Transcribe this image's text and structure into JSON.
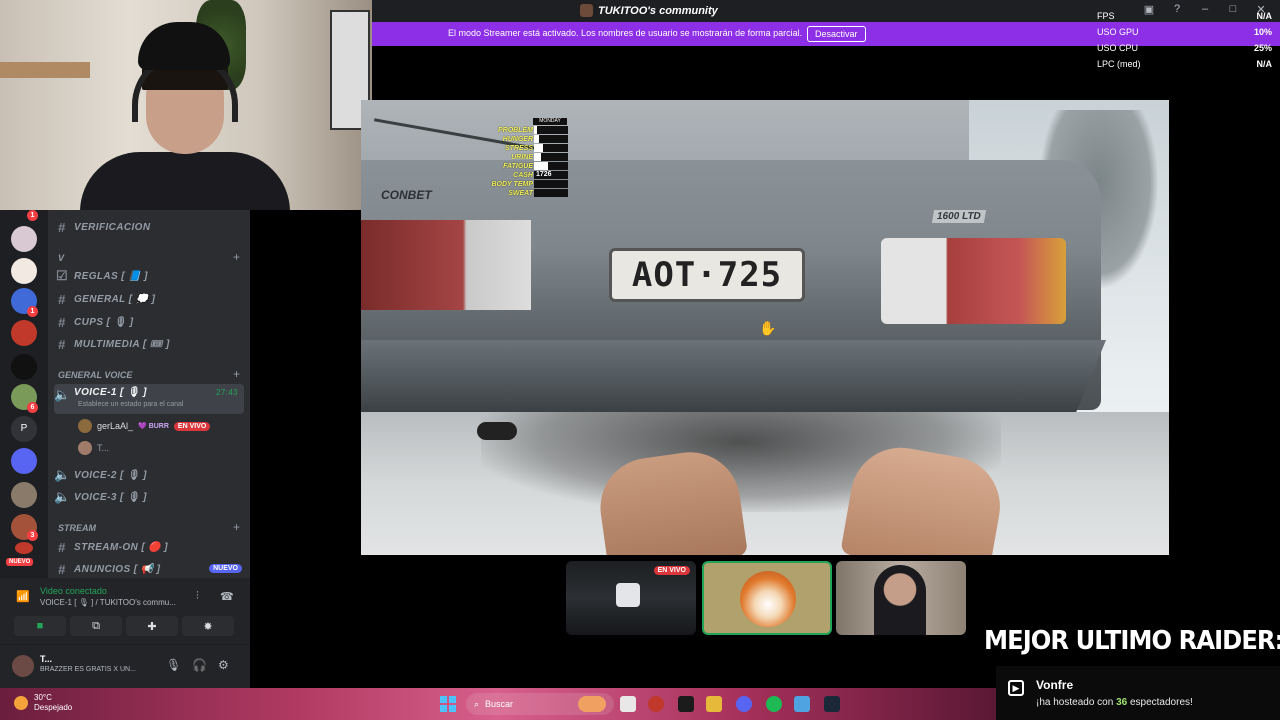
{
  "window": {
    "title": "TUKITOO's community"
  },
  "streamer_bar": {
    "message": "El modo Streamer está activado. Los nombres de usuario se mostrarán de forma parcial.",
    "button": "Desactivar"
  },
  "stats": [
    {
      "label": "FPS",
      "value": "N/A"
    },
    {
      "label": "USO GPU",
      "value": "10%"
    },
    {
      "label": "USO CPU",
      "value": "25%"
    },
    {
      "label": "LPC (med)",
      "value": "N/A"
    }
  ],
  "servers": {
    "new_label": "NUEVO"
  },
  "channels": {
    "top": [
      {
        "name": "VERIFICACION"
      }
    ],
    "cat1_label": "V",
    "list1": [
      {
        "name": "REGLAS [ 📘 ]"
      },
      {
        "name": "GENERAL [ 💭 ]"
      },
      {
        "name": "CUPS [ 🎙 ]"
      },
      {
        "name": "MULTIMEDIA [ 🎟 ]"
      }
    ],
    "cat2_label": "GENERAL VOICE",
    "active_voice": {
      "name": "VOICE-1 [ 🎙 ]",
      "timer": "27:43",
      "status": "Establece un estado para el canal"
    },
    "voice_users": [
      {
        "name": "gerLaAl_",
        "tag": "💜 BURR",
        "live": "EN VIVO"
      },
      {
        "name": "T..."
      }
    ],
    "voice_other": [
      {
        "name": "VOICE-2 [ 🎙 ]"
      },
      {
        "name": "VOICE-3 [ 🎙 ]"
      }
    ],
    "cat3_label": "STREAM",
    "stream": [
      {
        "name": "STREAM-ON [ 🔴 ]"
      },
      {
        "name": "ANUNCIOS [ 📢 ]",
        "badge": "NUEVO"
      }
    ]
  },
  "voice_panel": {
    "status": "Video conectado",
    "channel": "VOICE-1 [ 🎙 ] / TUKITOO's commu..."
  },
  "user_panel": {
    "name": "T...",
    "status": "BRAZZER ES GRATIS X UN..."
  },
  "hud": {
    "day": "MONDAY",
    "rows": [
      {
        "label": "PROBLEM",
        "level": 0.1
      },
      {
        "label": "HUNGER",
        "level": 0.15
      },
      {
        "label": "STRESS",
        "level": 0.25
      },
      {
        "label": "URINE",
        "level": 0.2
      },
      {
        "label": "FATIGUE",
        "level": 0.4
      },
      {
        "label": "CASH",
        "value": "1726"
      },
      {
        "label": "BODY TEMP",
        "level": 0
      },
      {
        "label": "SWEAT",
        "level": 0
      }
    ]
  },
  "game": {
    "plate": "AOT·725",
    "badge_left": "CONBET",
    "badge_right": "1600 LTD"
  },
  "tiles": {
    "live_label": "EN VIVO"
  },
  "overlay": {
    "raider_title": "MEJOR ULTIMO RAIDER:",
    "host_name": "Vonfre",
    "host_prefix": "¡ha hosteado con",
    "host_count": "36",
    "host_suffix": "espectadores!"
  },
  "taskbar": {
    "temp": "30°C",
    "weather": "Despejado",
    "search": "Buscar"
  }
}
